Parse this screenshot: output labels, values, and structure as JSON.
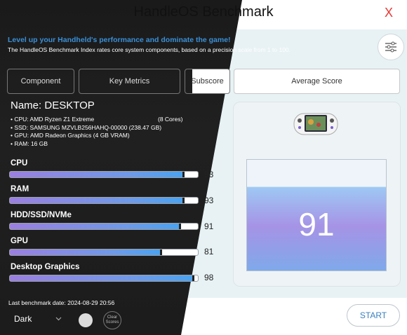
{
  "app": {
    "title": "HandleOS Benchmark",
    "close_label": "X"
  },
  "header": {
    "tagline": "Level up your Handheld's performance and dominate the game!",
    "description": "The HandleOS Benchmark Index rates core system components, based on a precision scale from 1 to 100."
  },
  "tabs": [
    {
      "label": "Component"
    },
    {
      "label": "Key Metrics"
    },
    {
      "label": "Subscore"
    },
    {
      "label": "Average Score"
    }
  ],
  "device": {
    "name_label": "Name:",
    "name": "DESKTOP",
    "specs": [
      "• CPU: AMD Ryzen Z1 Extreme",
      "• SSD: SAMSUNG MZVLB256HAHQ-00000 (238.47 GB)",
      "• GPU: AMD Radeon Graphics (4 GB VRAM)",
      "• RAM: 16 GB"
    ],
    "cpu_cores": "(8 Cores)"
  },
  "metrics": [
    {
      "label": "CPU",
      "score": 93
    },
    {
      "label": "RAM",
      "score": 93
    },
    {
      "label": "HDD/SSD/NVMe",
      "score": 91
    },
    {
      "label": "GPU",
      "score": 81
    },
    {
      "label": "Desktop Graphics",
      "score": 98
    }
  ],
  "average": {
    "score": "91"
  },
  "footer": {
    "last_benchmark_label": "Last benchmark date:",
    "last_benchmark_date": "2024-08-29 20:56",
    "theme_value": "Dark",
    "clear_label": "Clear Scores",
    "start_label": "START"
  },
  "colors": {
    "accent": "#3a8fd6",
    "close": "#e53935"
  }
}
